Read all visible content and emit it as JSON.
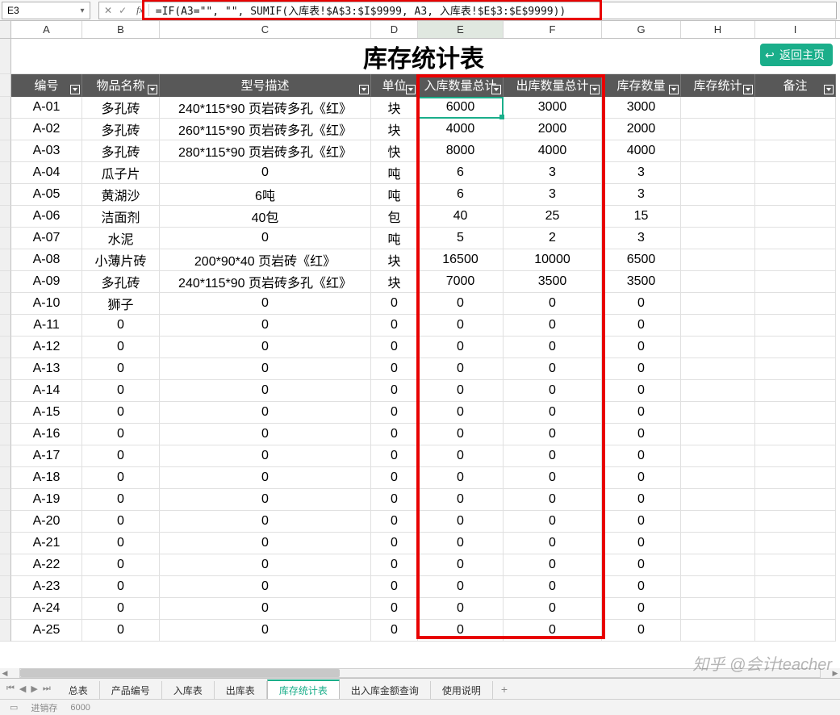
{
  "name_box": "E3",
  "fx_label": "fx",
  "formula": "=IF(A3=\"\", \"\", SUMIF(入库表!$A$3:$I$9999, A3, 入库表!$E$3:$E$9999))",
  "columns": [
    "A",
    "B",
    "C",
    "D",
    "E",
    "F",
    "G",
    "H",
    "I"
  ],
  "title": "库存统计表",
  "home_btn": "返回主页",
  "headers": [
    "编号",
    "物品名称",
    "型号描述",
    "单位",
    "入库数量总计",
    "出库数量总计",
    "库存数量",
    "库存统计",
    "备注"
  ],
  "rows": [
    {
      "a": "A-01",
      "b": "多孔砖",
      "c": "240*115*90 页岩砖多孔《红》",
      "d": "块",
      "e": "6000",
      "f": "3000",
      "g": "3000",
      "h": "",
      "i": ""
    },
    {
      "a": "A-02",
      "b": "多孔砖",
      "c": "260*115*90 页岩砖多孔《红》",
      "d": "块",
      "e": "4000",
      "f": "2000",
      "g": "2000",
      "h": "",
      "i": ""
    },
    {
      "a": "A-03",
      "b": "多孔砖",
      "c": "280*115*90 页岩砖多孔《红》",
      "d": "快",
      "e": "8000",
      "f": "4000",
      "g": "4000",
      "h": "",
      "i": ""
    },
    {
      "a": "A-04",
      "b": "瓜子片",
      "c": "0",
      "d": "吨",
      "e": "6",
      "f": "3",
      "g": "3",
      "h": "",
      "i": ""
    },
    {
      "a": "A-05",
      "b": "黄湖沙",
      "c": "6吨",
      "d": "吨",
      "e": "6",
      "f": "3",
      "g": "3",
      "h": "",
      "i": ""
    },
    {
      "a": "A-06",
      "b": "洁面剂",
      "c": "40包",
      "d": "包",
      "e": "40",
      "f": "25",
      "g": "15",
      "h": "",
      "i": ""
    },
    {
      "a": "A-07",
      "b": "水泥",
      "c": "0",
      "d": "吨",
      "e": "5",
      "f": "2",
      "g": "3",
      "h": "",
      "i": ""
    },
    {
      "a": "A-08",
      "b": "小薄片砖",
      "c": "200*90*40 页岩砖《红》",
      "d": "块",
      "e": "16500",
      "f": "10000",
      "g": "6500",
      "h": "",
      "i": ""
    },
    {
      "a": "A-09",
      "b": "多孔砖",
      "c": "240*115*90 页岩砖多孔《红》",
      "d": "块",
      "e": "7000",
      "f": "3500",
      "g": "3500",
      "h": "",
      "i": ""
    },
    {
      "a": "A-10",
      "b": "狮子",
      "c": "0",
      "d": "0",
      "e": "0",
      "f": "0",
      "g": "0",
      "h": "",
      "i": ""
    },
    {
      "a": "A-11",
      "b": "0",
      "c": "0",
      "d": "0",
      "e": "0",
      "f": "0",
      "g": "0",
      "h": "",
      "i": ""
    },
    {
      "a": "A-12",
      "b": "0",
      "c": "0",
      "d": "0",
      "e": "0",
      "f": "0",
      "g": "0",
      "h": "",
      "i": ""
    },
    {
      "a": "A-13",
      "b": "0",
      "c": "0",
      "d": "0",
      "e": "0",
      "f": "0",
      "g": "0",
      "h": "",
      "i": ""
    },
    {
      "a": "A-14",
      "b": "0",
      "c": "0",
      "d": "0",
      "e": "0",
      "f": "0",
      "g": "0",
      "h": "",
      "i": ""
    },
    {
      "a": "A-15",
      "b": "0",
      "c": "0",
      "d": "0",
      "e": "0",
      "f": "0",
      "g": "0",
      "h": "",
      "i": ""
    },
    {
      "a": "A-16",
      "b": "0",
      "c": "0",
      "d": "0",
      "e": "0",
      "f": "0",
      "g": "0",
      "h": "",
      "i": ""
    },
    {
      "a": "A-17",
      "b": "0",
      "c": "0",
      "d": "0",
      "e": "0",
      "f": "0",
      "g": "0",
      "h": "",
      "i": ""
    },
    {
      "a": "A-18",
      "b": "0",
      "c": "0",
      "d": "0",
      "e": "0",
      "f": "0",
      "g": "0",
      "h": "",
      "i": ""
    },
    {
      "a": "A-19",
      "b": "0",
      "c": "0",
      "d": "0",
      "e": "0",
      "f": "0",
      "g": "0",
      "h": "",
      "i": ""
    },
    {
      "a": "A-20",
      "b": "0",
      "c": "0",
      "d": "0",
      "e": "0",
      "f": "0",
      "g": "0",
      "h": "",
      "i": ""
    },
    {
      "a": "A-21",
      "b": "0",
      "c": "0",
      "d": "0",
      "e": "0",
      "f": "0",
      "g": "0",
      "h": "",
      "i": ""
    },
    {
      "a": "A-22",
      "b": "0",
      "c": "0",
      "d": "0",
      "e": "0",
      "f": "0",
      "g": "0",
      "h": "",
      "i": ""
    },
    {
      "a": "A-23",
      "b": "0",
      "c": "0",
      "d": "0",
      "e": "0",
      "f": "0",
      "g": "0",
      "h": "",
      "i": ""
    },
    {
      "a": "A-24",
      "b": "0",
      "c": "0",
      "d": "0",
      "e": "0",
      "f": "0",
      "g": "0",
      "h": "",
      "i": ""
    },
    {
      "a": "A-25",
      "b": "0",
      "c": "0",
      "d": "0",
      "e": "0",
      "f": "0",
      "g": "0",
      "h": "",
      "i": ""
    }
  ],
  "tabs": [
    "总表",
    "产品编号",
    "入库表",
    "出库表",
    "库存统计表",
    "出入库金额查询",
    "使用说明"
  ],
  "active_tab": 4,
  "status": {
    "label": "进销存",
    "value": "6000"
  },
  "watermark": "知乎 @会计teacher"
}
